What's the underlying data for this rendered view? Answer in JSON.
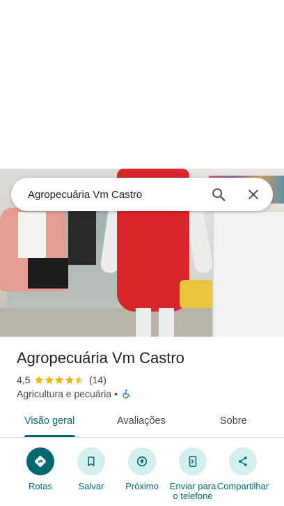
{
  "search": {
    "query": "Agropecuária Vm Castro",
    "search_icon": "search-icon",
    "close_icon": "close-icon"
  },
  "place": {
    "name": "Agropecuária Vm Castro",
    "rating": "4,5",
    "stars": 4.5,
    "review_count": "(14)",
    "category": "Agricultura e pecuária",
    "separator": "•",
    "accessibility_icon": "wheelchair-icon"
  },
  "tabs": [
    {
      "label": "Visão geral",
      "active": true
    },
    {
      "label": "Avaliações",
      "active": false
    },
    {
      "label": "Sobre",
      "active": false
    }
  ],
  "actions": [
    {
      "label": "Rotas",
      "icon": "directions-icon"
    },
    {
      "label": "Salvar",
      "icon": "bookmark-icon"
    },
    {
      "label": "Próximo",
      "icon": "nearby-icon"
    },
    {
      "label": "Enviar para o telefone",
      "icon": "send-to-phone-icon"
    },
    {
      "label": "Compartilhar",
      "icon": "share-icon"
    }
  ],
  "colors": {
    "accent": "#00696f",
    "accent_light": "#d3f0ee",
    "star": "#f4b400",
    "text_primary": "#1f1f1f",
    "text_secondary": "#444746"
  }
}
